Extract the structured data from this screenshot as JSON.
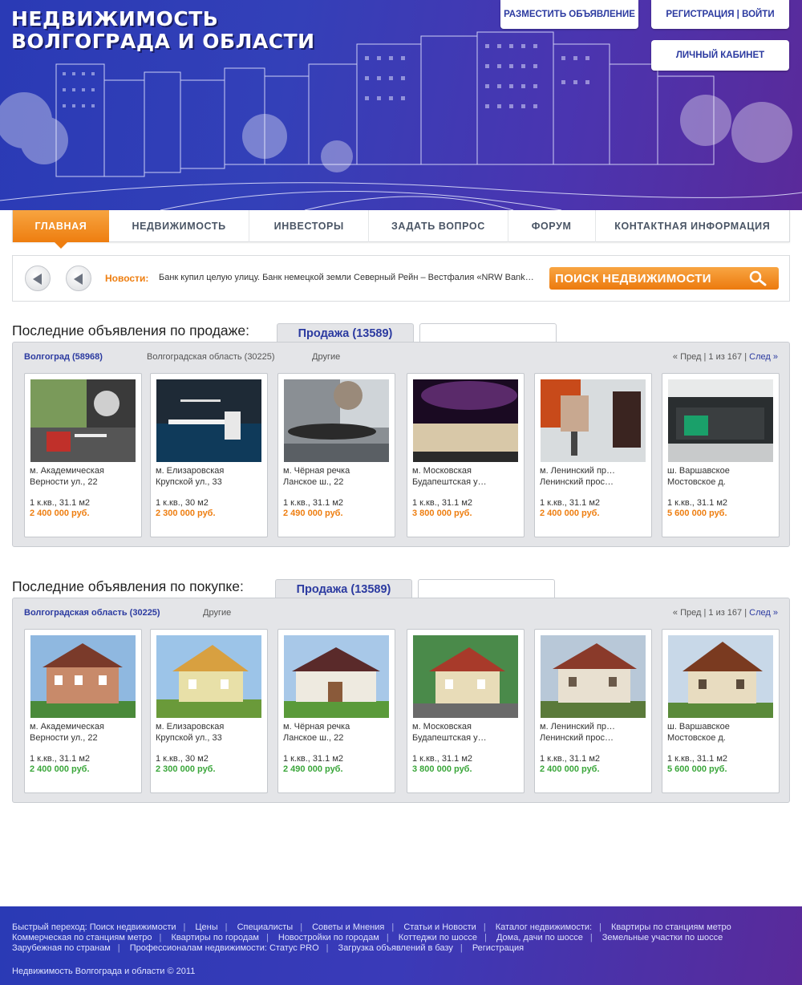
{
  "header": {
    "logo_line1": "НЕДВИЖИМОСТЬ",
    "logo_line2": "ВОЛГОГРАДА И ОБЛАСТИ",
    "post_ad": "РАЗМЕСТИТЬ ОБЪЯВЛЕНИЕ",
    "register_login": "РЕГИСТРАЦИЯ | ВОЙТИ",
    "cabinet": "ЛИЧНЫЙ КАБИНЕТ"
  },
  "nav": [
    {
      "label": "ГЛАВНАЯ"
    },
    {
      "label": "НЕДВИЖИМОСТЬ"
    },
    {
      "label": "ИНВЕСТОРЫ"
    },
    {
      "label": "ЗАДАТЬ ВОПРОС"
    },
    {
      "label": "ФОРУМ"
    },
    {
      "label": "КОНТАКТНАЯ ИНФОРМАЦИЯ"
    }
  ],
  "news": {
    "label": "Новости:",
    "text": "Банк купил целую улицу. Банк немецкой земли Северный Рейн – Вестфалия «NRW Bank»…",
    "search": "ПОИСК НЕДВИЖИМОСТИ"
  },
  "sale": {
    "title": "Последние объявления по продаже:",
    "tab": "Продажа (13589)",
    "filters": [
      "Волгоград (58968)",
      "Волгоградская область (30225)",
      "Другие"
    ],
    "pager_prev": "« Пред",
    "pager_info": "1 из 167",
    "pager_next": "След »",
    "cards": [
      {
        "l1": "м. Академическая",
        "l2": "Верности ул., 22",
        "l3": "1 к.кв., 31.1 м2",
        "price": "2 400 000 руб."
      },
      {
        "l1": "м. Елизаровская",
        "l2": "Крупской ул., 33",
        "l3": "1 к.кв., 30 м2",
        "price": "2 300 000 руб."
      },
      {
        "l1": "м. Чёрная речка",
        "l2": "Ланское ш., 22",
        "l3": "1 к.кв., 31.1 м2",
        "price": "2 490 000 руб."
      },
      {
        "l1": "м. Московская",
        "l2": "Будапештская у…",
        "l3": "1 к.кв., 31.1 м2",
        "price": "3 800 000 руб."
      },
      {
        "l1": "м. Ленинский пр…",
        "l2": "Ленинский прос…",
        "l3": "1 к.кв., 31.1 м2",
        "price": "2 400 000 руб."
      },
      {
        "l1": "ш. Варшавское",
        "l2": "Мостовское д.",
        "l3": "1 к.кв., 31.1 м2",
        "price": "5 600 000 руб."
      }
    ]
  },
  "buy": {
    "title": "Последние объявления по покупке:",
    "tab": "Продажа (13589)",
    "filters": [
      "Волгоградская область (30225)",
      "Другие"
    ],
    "pager_prev": "« Пред",
    "pager_info": "1 из 167",
    "pager_next": "След »",
    "cards": [
      {
        "l1": "м. Академическая",
        "l2": "Верности ул., 22",
        "l3": "1 к.кв., 31.1 м2",
        "price": "2 400 000 руб."
      },
      {
        "l1": "м. Елизаровская",
        "l2": "Крупской ул., 33",
        "l3": "1 к.кв., 30 м2",
        "price": "2 300 000 руб."
      },
      {
        "l1": "м. Чёрная речка",
        "l2": "Ланское ш., 22",
        "l3": "1 к.кв., 31.1 м2",
        "price": "2 490 000 руб."
      },
      {
        "l1": "м. Московская",
        "l2": "Будапештская у…",
        "l3": "1 к.кв., 31.1 м2",
        "price": "3 800 000 руб."
      },
      {
        "l1": "м. Ленинский пр…",
        "l2": "Ленинский прос…",
        "l3": "1 к.кв., 31.1 м2",
        "price": "2 400 000 руб."
      },
      {
        "l1": "ш. Варшавское",
        "l2": "Мостовское д.",
        "l3": "1 к.кв., 31.1 м2",
        "price": "5 600 000 руб."
      }
    ]
  },
  "footer": {
    "row1": [
      "Быстрый переход: Поиск недвижимости",
      "Цены",
      "Специалисты",
      "Советы и Мнения",
      "Статьи и Новости",
      "Каталог недвижимости:",
      "Квартиры по станциям метро"
    ],
    "row2": [
      "Коммерческая по станциям метро",
      "Квартиры по городам",
      "Новостройки по городам",
      "Коттеджи по шоссе",
      "Дома, дачи по шоссе",
      "Земельные участки по шоссе"
    ],
    "row3": [
      "Зарубежная по странам",
      "Профессионалам недвижимости: Статус PRO",
      "Загрузка объявлений в базу",
      "Регистрация"
    ],
    "copyright": "Недвижимость Волгограда и области © 2011"
  },
  "colors": {
    "brand_blue": "#2b3aa0",
    "accent_orange": "#ee7e10",
    "price_green": "#3aa63a"
  }
}
